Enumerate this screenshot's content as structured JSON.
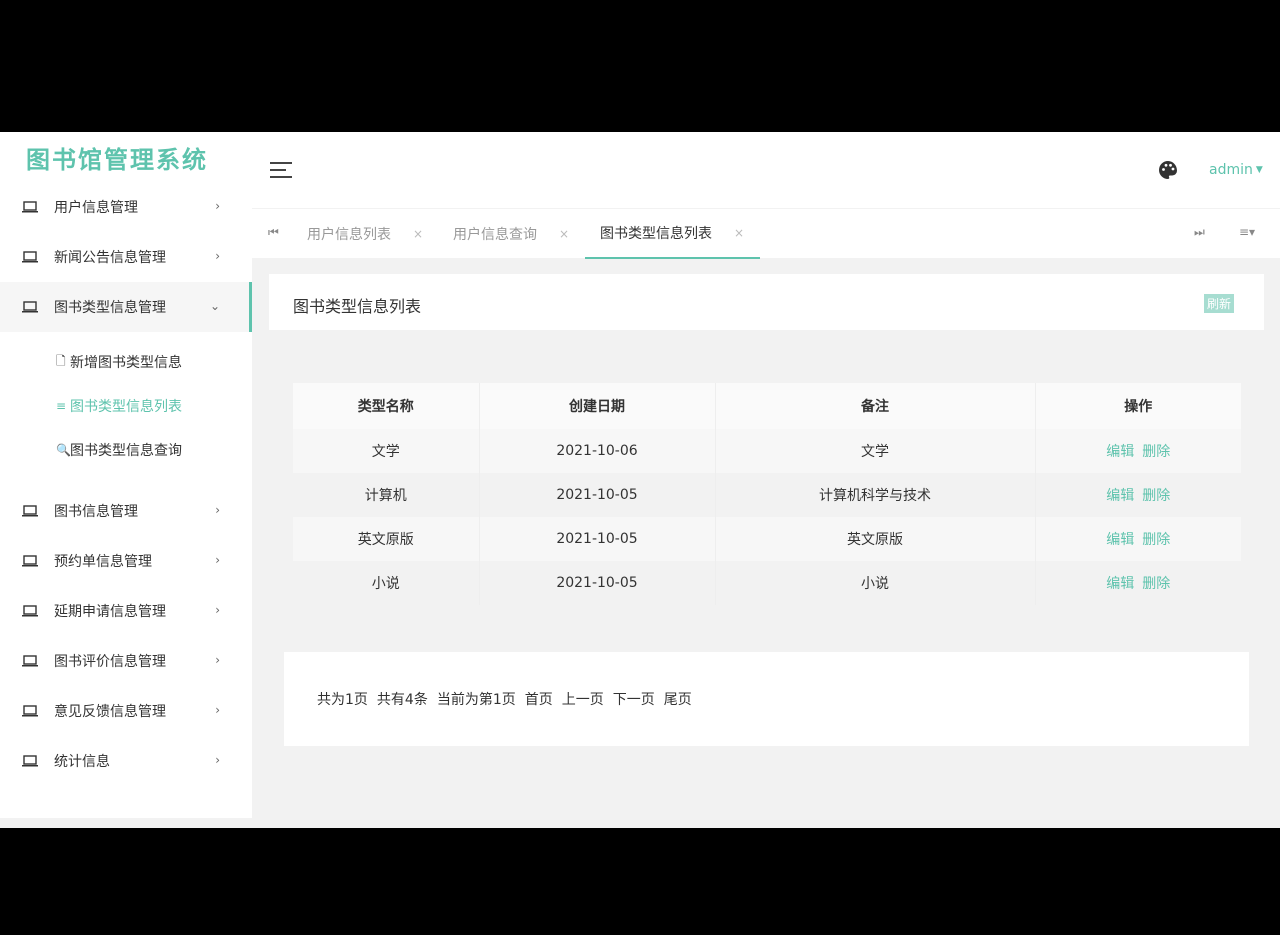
{
  "app": {
    "title": "图书馆管理系统"
  },
  "sidebar": {
    "items": [
      {
        "label": "用户信息管理"
      },
      {
        "label": "新闻公告信息管理"
      },
      {
        "label": "图书类型信息管理"
      },
      {
        "label": "图书信息管理"
      },
      {
        "label": "预约单信息管理"
      },
      {
        "label": "延期申请信息管理"
      },
      {
        "label": "图书评价信息管理"
      },
      {
        "label": "意见反馈信息管理"
      },
      {
        "label": "统计信息"
      }
    ],
    "submenu": [
      {
        "label": "新增图书类型信息",
        "icon": "file-icon"
      },
      {
        "label": "图书类型信息列表",
        "icon": "list-icon"
      },
      {
        "label": "图书类型信息查询",
        "icon": "search-icon"
      }
    ]
  },
  "header": {
    "user": "admin"
  },
  "tabs": [
    {
      "label": "用户信息列表"
    },
    {
      "label": "用户信息查询"
    },
    {
      "label": "图书类型信息列表"
    }
  ],
  "tab_close": "×",
  "page": {
    "title": "图书类型信息列表",
    "refresh_label": "刷新"
  },
  "table": {
    "columns": [
      "类型名称",
      "创建日期",
      "备注",
      "操作"
    ],
    "rows": [
      {
        "name": "文学",
        "date": "2021-10-06",
        "note": "文学"
      },
      {
        "name": "计算机",
        "date": "2021-10-05",
        "note": "计算机科学与技术"
      },
      {
        "name": "英文原版",
        "date": "2021-10-05",
        "note": "英文原版"
      },
      {
        "name": "小说",
        "date": "2021-10-05",
        "note": "小说"
      }
    ],
    "edit_label": "编辑",
    "delete_label": "删除"
  },
  "pager": {
    "total_pages": "共为1页",
    "total_items": "共有4条",
    "current": "当前为第1页",
    "first": "首页",
    "prev": "上一页",
    "next": "下一页",
    "last": "尾页"
  },
  "colors": {
    "accent": "#5ec3ad"
  }
}
